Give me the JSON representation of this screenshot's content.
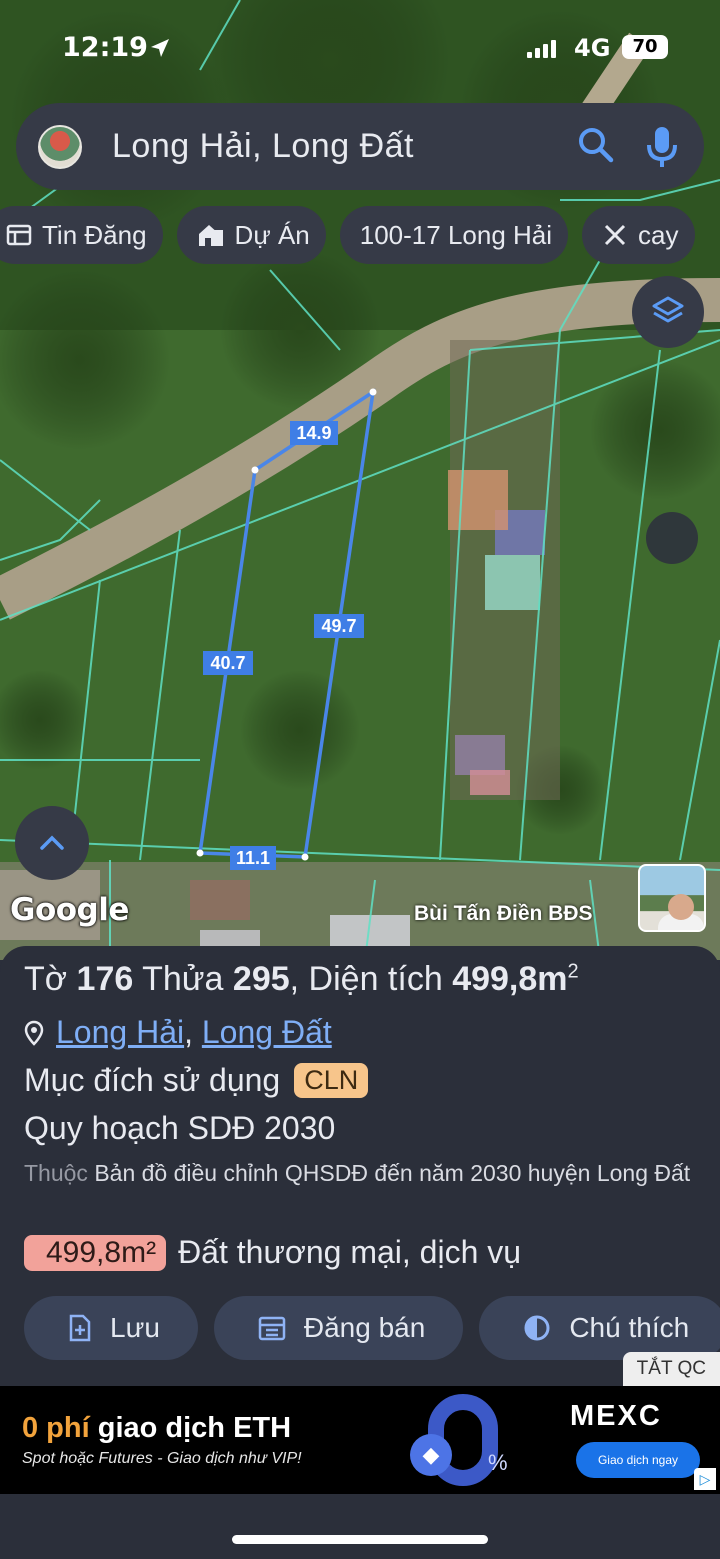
{
  "status_bar": {
    "time": "12:19",
    "network": "4G",
    "battery": "70"
  },
  "search": {
    "query": "Long Hải, Long Đất"
  },
  "chips": [
    {
      "label": "Tin Đăng",
      "icon": "listing-icon"
    },
    {
      "label": "Dự Án",
      "icon": "project-icon"
    },
    {
      "label": "100-17 Long Hải",
      "icon": ""
    },
    {
      "label": "cay",
      "icon": "measure-icon"
    }
  ],
  "map": {
    "edge_labels": {
      "top": "14.9",
      "right": "49.7",
      "left": "40.7",
      "bottom": "11.1"
    },
    "google_logo": "Google",
    "credit": "Bùi Tấn Điền BĐS"
  },
  "parcel": {
    "sheet_label": "Tờ",
    "sheet_number": "176",
    "lot_label": "Thửa",
    "lot_number": "295",
    "area_label": ", Diện tích",
    "area_value": "499,8m",
    "area_sup": "2",
    "commune": "Long Hải",
    "district": "Long Đất",
    "purpose_label": "Mục đích sử dụng",
    "purpose_code": "CLN",
    "plan_title": "Quy hoạch SDĐ 2030",
    "plan_prefix": "Thuộc",
    "plan_desc": "Bản đồ điều chỉnh QHSDĐ đến năm 2030 huyện Long Đất",
    "zone_area": "499,8m²",
    "zone_type": "Đất thương mại, dịch vụ"
  },
  "actions": {
    "save": "Lưu",
    "post": "Đăng bán",
    "legend": "Chú thích"
  },
  "ad": {
    "hide_label": "TẮT QC",
    "headline_highlight": "0 phí",
    "headline_rest": " giao dịch ETH",
    "subline": "Spot hoặc Futures - Giao dịch như VIP!",
    "brand": "MEXC",
    "cta": "Giao dịch ngay",
    "percent": "%"
  },
  "colors": {
    "parcel_outline": "#4a86e8",
    "cadastral_lines": "#5fe0c4",
    "sheet_bg": "#2b2f3a",
    "chip_bg": "#363a47",
    "link": "#7faef5"
  }
}
